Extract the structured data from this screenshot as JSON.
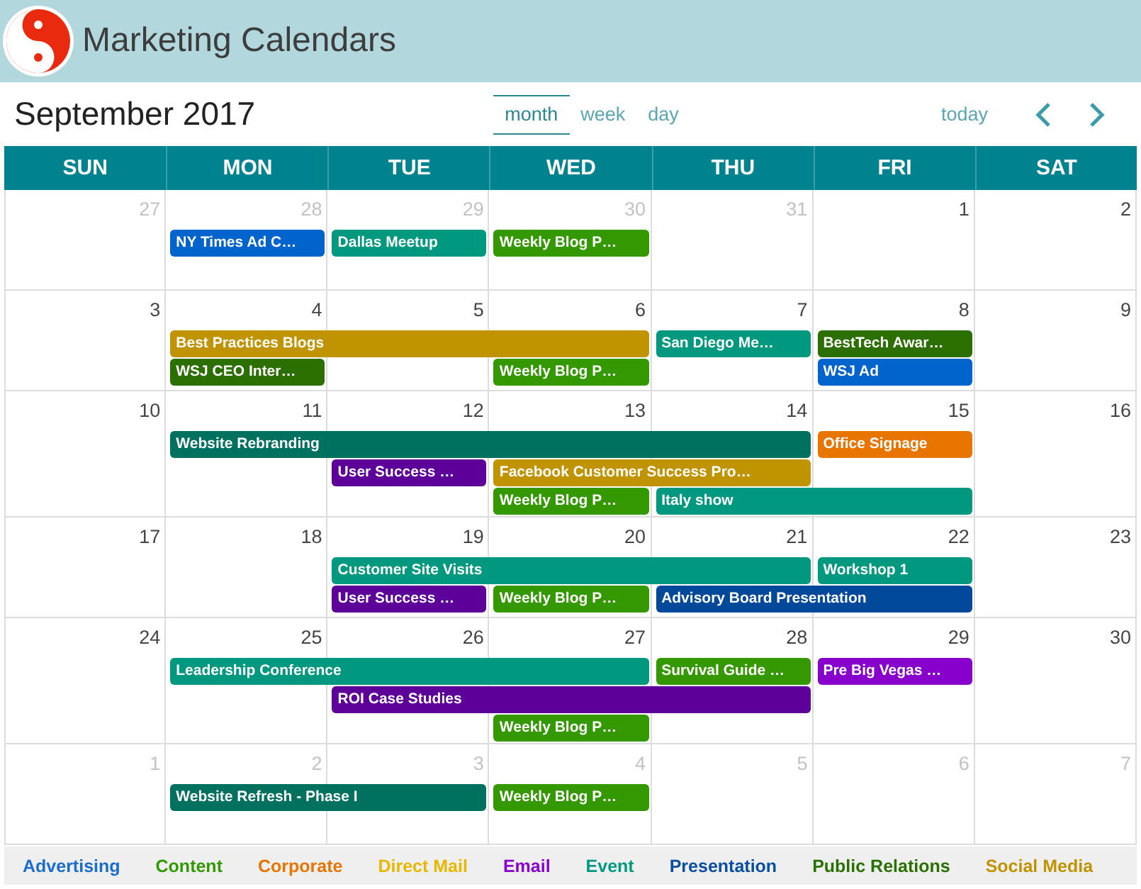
{
  "header": {
    "title": "Marketing Calendars"
  },
  "toolbar": {
    "title": "September 2017",
    "views": [
      {
        "label": "month",
        "selected": true
      },
      {
        "label": "week",
        "selected": false
      },
      {
        "label": "day",
        "selected": false
      }
    ],
    "today": "today"
  },
  "calendar": {
    "weekdays": [
      "SUN",
      "MON",
      "TUE",
      "WED",
      "THU",
      "FRI",
      "SAT"
    ],
    "weeks": [
      {
        "days": [
          {
            "number": "27",
            "other_month": true
          },
          {
            "number": "28",
            "other_month": true,
            "events": [
              {
                "kind": "start",
                "title": "NY Times Ad C…",
                "color": "#0064cc"
              }
            ]
          },
          {
            "number": "29",
            "other_month": true,
            "events": [
              {
                "kind": "start",
                "title": "Dallas Meetup",
                "color": "#00997f"
              }
            ]
          },
          {
            "number": "30",
            "other_month": true,
            "events": [
              {
                "kind": "start",
                "title": "Weekly Blog P…",
                "color": "#349900"
              }
            ]
          },
          {
            "number": "31",
            "other_month": true
          },
          {
            "number": "1",
            "other_month": false
          },
          {
            "number": "2",
            "other_month": false
          }
        ]
      },
      {
        "days": [
          {
            "number": "3",
            "other_month": false
          },
          {
            "number": "4",
            "other_month": false,
            "events": [
              {
                "kind": "start",
                "title": "Best Practices Blogs",
                "color": "#c09400"
              },
              {
                "kind": "start",
                "title": "WSJ CEO Inter…",
                "color": "#2a6f00"
              }
            ]
          },
          {
            "number": "5",
            "other_month": false,
            "events": [
              {
                "kind": "continued"
              }
            ]
          },
          {
            "number": "6",
            "other_month": false,
            "events": [
              {
                "kind": "continued"
              },
              {
                "kind": "start",
                "title": "Weekly Blog P…",
                "color": "#349900"
              }
            ]
          },
          {
            "number": "7",
            "other_month": false,
            "events": [
              {
                "kind": "start",
                "title": "San Diego Me…",
                "color": "#00997f"
              }
            ]
          },
          {
            "number": "8",
            "other_month": false,
            "events": [
              {
                "kind": "start",
                "title": "BestTech Awar…",
                "color": "#2a6f00"
              },
              {
                "kind": "start",
                "title": "WSJ Ad",
                "color": "#0064cc"
              }
            ]
          },
          {
            "number": "9",
            "other_month": false
          }
        ]
      },
      {
        "days": [
          {
            "number": "10",
            "other_month": false
          },
          {
            "number": "11",
            "other_month": false,
            "events": [
              {
                "kind": "start",
                "title": "Website Rebranding",
                "color": "#00705f"
              }
            ]
          },
          {
            "number": "12",
            "other_month": false,
            "events": [
              {
                "kind": "continued"
              },
              {
                "kind": "start",
                "title": "User Success …",
                "color": "#5c0099"
              }
            ]
          },
          {
            "number": "13",
            "other_month": false,
            "events": [
              {
                "kind": "continued"
              },
              {
                "kind": "start",
                "title": "Facebook Customer Success Pro…",
                "color": "#c09400"
              },
              {
                "kind": "start",
                "title": "Weekly Blog P…",
                "color": "#349900"
              }
            ]
          },
          {
            "number": "14",
            "other_month": false,
            "events": [
              {
                "kind": "continued"
              },
              {
                "kind": "continued"
              },
              {
                "kind": "start",
                "title": "Italy show",
                "color": "#00997f"
              }
            ]
          },
          {
            "number": "15",
            "other_month": false,
            "events": [
              {
                "kind": "start",
                "title": "Office Signage",
                "color": "#e87500"
              },
              {
                "kind": "blank"
              },
              {
                "kind": "continued"
              }
            ]
          },
          {
            "number": "16",
            "other_month": false
          }
        ]
      },
      {
        "days": [
          {
            "number": "17",
            "other_month": false
          },
          {
            "number": "18",
            "other_month": false
          },
          {
            "number": "19",
            "other_month": false,
            "events": [
              {
                "kind": "start",
                "title": "Customer Site Visits",
                "color": "#00997f"
              },
              {
                "kind": "start",
                "title": "User Success …",
                "color": "#5c0099"
              }
            ]
          },
          {
            "number": "20",
            "other_month": false,
            "events": [
              {
                "kind": "continued"
              },
              {
                "kind": "start",
                "title": "Weekly Blog P…",
                "color": "#349900"
              }
            ]
          },
          {
            "number": "21",
            "other_month": false,
            "events": [
              {
                "kind": "continued"
              },
              {
                "kind": "start",
                "title": "Advisory Board Presentation",
                "color": "#00499a"
              }
            ]
          },
          {
            "number": "22",
            "other_month": false,
            "events": [
              {
                "kind": "start",
                "title": "Workshop 1",
                "color": "#00997f"
              },
              {
                "kind": "continued"
              }
            ]
          },
          {
            "number": "23",
            "other_month": false
          }
        ]
      },
      {
        "days": [
          {
            "number": "24",
            "other_month": false
          },
          {
            "number": "25",
            "other_month": false,
            "events": [
              {
                "kind": "start",
                "title": "Leadership Conference",
                "color": "#00997f"
              }
            ]
          },
          {
            "number": "26",
            "other_month": false,
            "events": [
              {
                "kind": "continued"
              },
              {
                "kind": "start",
                "title": "ROI Case Studies",
                "color": "#5c0099"
              }
            ]
          },
          {
            "number": "27",
            "other_month": false,
            "events": [
              {
                "kind": "continued"
              },
              {
                "kind": "continued"
              },
              {
                "kind": "start",
                "title": "Weekly Blog P…",
                "color": "#349900"
              }
            ]
          },
          {
            "number": "28",
            "other_month": false,
            "events": [
              {
                "kind": "start",
                "title": "Survival Guide …",
                "color": "#349900"
              },
              {
                "kind": "continued"
              }
            ]
          },
          {
            "number": "29",
            "other_month": false,
            "events": [
              {
                "kind": "start",
                "title": "Pre Big Vegas …",
                "color": "#8800cc"
              }
            ]
          },
          {
            "number": "30",
            "other_month": false
          }
        ]
      },
      {
        "days": [
          {
            "number": "1",
            "other_month": true
          },
          {
            "number": "2",
            "other_month": true,
            "events": [
              {
                "kind": "start",
                "title": "Website Refresh - Phase I",
                "color": "#00705f"
              }
            ]
          },
          {
            "number": "3",
            "other_month": true,
            "events": [
              {
                "kind": "continued"
              }
            ]
          },
          {
            "number": "4",
            "other_month": true,
            "events": [
              {
                "kind": "start",
                "title": "Weekly Blog P…",
                "color": "#349900"
              }
            ]
          },
          {
            "number": "5",
            "other_month": true
          },
          {
            "number": "6",
            "other_month": true
          },
          {
            "number": "7",
            "other_month": true
          }
        ]
      }
    ]
  },
  "legend": [
    {
      "label": "Advertising",
      "color": "#1a6dcc"
    },
    {
      "label": "Content",
      "color": "#339900"
    },
    {
      "label": "Corporate",
      "color": "#e87500"
    },
    {
      "label": "Direct Mail",
      "color": "#e6b800"
    },
    {
      "label": "Email",
      "color": "#8a00cc"
    },
    {
      "label": "Event",
      "color": "#009980"
    },
    {
      "label": "Presentation",
      "color": "#0a4ea0"
    },
    {
      "label": "Public Relations",
      "color": "#2a7000"
    },
    {
      "label": "Social Media",
      "color": "#c09400"
    }
  ]
}
